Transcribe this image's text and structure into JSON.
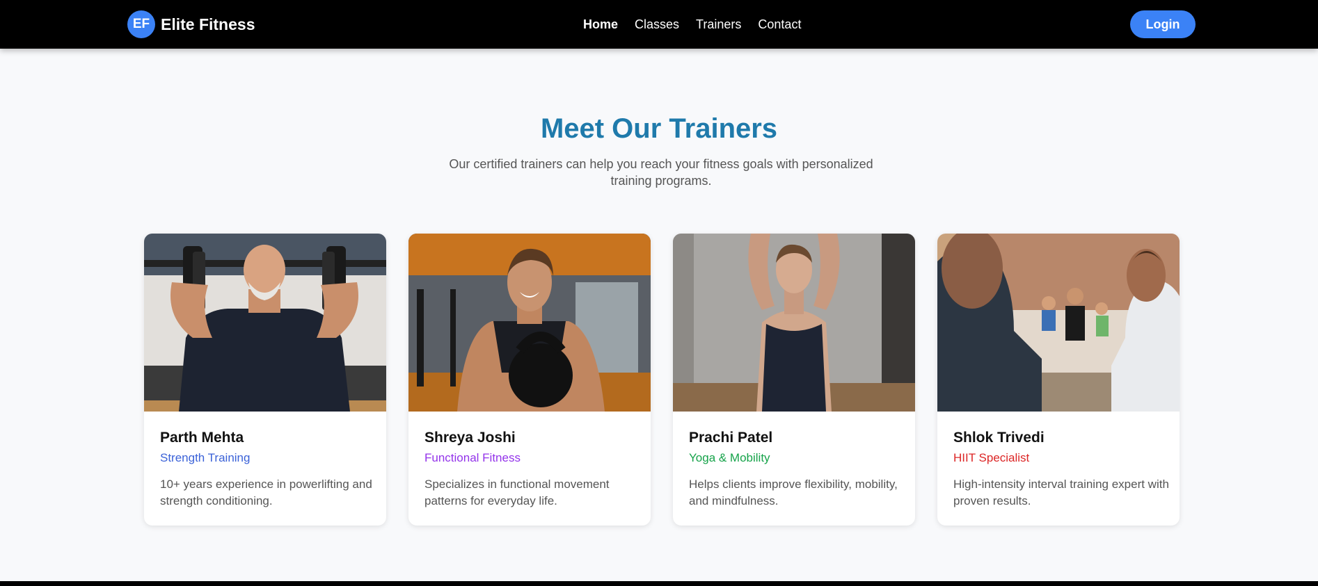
{
  "brand": {
    "badge": "EF",
    "name": "Elite Fitness"
  },
  "nav": {
    "links": [
      {
        "label": "Home",
        "active": true
      },
      {
        "label": "Classes",
        "active": false
      },
      {
        "label": "Trainers",
        "active": false
      },
      {
        "label": "Contact",
        "active": false
      }
    ],
    "login_label": "Login"
  },
  "colors": {
    "accent": "#3b82f6",
    "heading": "#1f7aab",
    "role_strength": "#3b62d8",
    "role_functional": "#9333ea",
    "role_yoga": "#16a34a",
    "role_hiit": "#dc2626"
  },
  "section": {
    "title": "Meet Our Trainers",
    "subtitle": "Our certified trainers can help you reach your fitness goals with personalized training programs."
  },
  "trainers": [
    {
      "name": "Parth Mehta",
      "role": "Strength Training",
      "description": "10+ years experience in powerlifting and strength conditioning.",
      "photo": "man-lifting-barbell-photo"
    },
    {
      "name": "Shreya Joshi",
      "role": "Functional Fitness",
      "description": "Specializes in functional movement patterns for everyday life.",
      "photo": "woman-holding-kettlebell-photo"
    },
    {
      "name": "Prachi Patel",
      "role": "Yoga & Mobility",
      "description": "Helps clients improve flexibility, mobility, and mindfulness.",
      "photo": "woman-stretching-photo"
    },
    {
      "name": "Shlok Trivedi",
      "role": "HIIT Specialist",
      "description": "High-intensity interval training expert with proven results.",
      "photo": "group-training-class-photo"
    }
  ]
}
